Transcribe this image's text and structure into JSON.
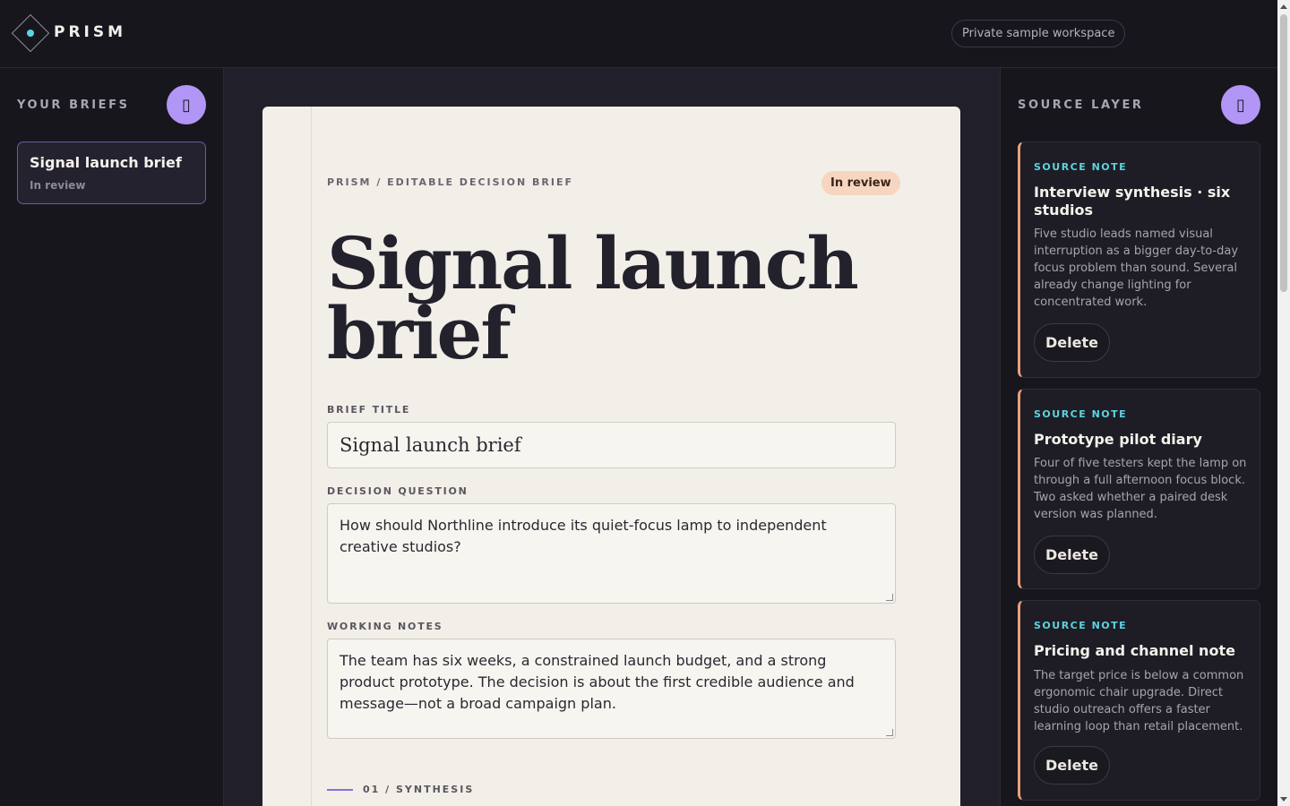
{
  "app": {
    "name": "PRISM",
    "workspace": "Private sample workspace"
  },
  "sidebar": {
    "title": "YOUR BRIEFS",
    "add_icon": "plus-icon",
    "briefs": [
      {
        "name": "Signal launch brief",
        "status": "In review"
      }
    ]
  },
  "brief": {
    "kicker": "PRISM / EDITABLE DECISION BRIEF",
    "status_badge": "In review",
    "heading": "Signal launch brief",
    "title_label": "BRIEF TITLE",
    "title_value": "Signal launch brief",
    "question_label": "DECISION QUESTION",
    "question_value": "How should Northline introduce its quiet-focus lamp to independent creative studios?",
    "notes_label": "WORKING NOTES",
    "notes_value": "The team has six weeks, a constrained launch budget, and a strong product prototype. The decision is about the first credible audience and message—not a broad campaign plan.",
    "section_label": "01 / SYNTHESIS"
  },
  "source_layer": {
    "title": "SOURCE LAYER",
    "add_icon": "plus-icon",
    "notes": [
      {
        "kicker": "SOURCE NOTE",
        "title": "Interview synthesis · six studios",
        "body": "Five studio leads named visual interruption as a bigger day-to-day focus problem than sound. Several already change lighting for concentrated work.",
        "delete_label": "Delete"
      },
      {
        "kicker": "SOURCE NOTE",
        "title": "Prototype pilot diary",
        "body": "Four of five testers kept the lamp on through a full afternoon focus block. Two asked whether a paired desk version was planned.",
        "delete_label": "Delete"
      },
      {
        "kicker": "SOURCE NOTE",
        "title": "Pricing and channel note",
        "body": "The target price is below a common ergonomic chair upgrade. Direct studio outreach offers a faster learning loop than retail placement.",
        "delete_label": "Delete"
      }
    ]
  },
  "colors": {
    "accent": "#b196f6",
    "source_kicker": "#5ed3e0",
    "note_edge": "#e7a07a",
    "badge_bg": "#f6d6c1"
  }
}
